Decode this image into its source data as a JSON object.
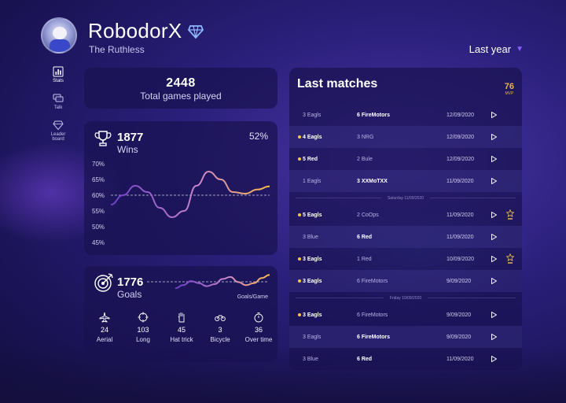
{
  "profile": {
    "name": "RobodorX",
    "title": "The Ruthless",
    "rank_icon": "diamond-icon"
  },
  "period": {
    "label": "Last year"
  },
  "nav": [
    {
      "label": "Stats",
      "icon": "bar-chart-icon",
      "active": true
    },
    {
      "label": "Talk",
      "icon": "chat-icon",
      "active": false
    },
    {
      "label": "Leader board",
      "icon": "diamond-icon",
      "active": false
    }
  ],
  "total": {
    "value": "2448",
    "label": "Total games played"
  },
  "wins": {
    "value": "1877",
    "label": "Wins",
    "percent": "52%",
    "chart_data": {
      "type": "line",
      "yticks": [
        "70%",
        "65%",
        "60%",
        "55%",
        "50%",
        "45%"
      ],
      "ylim": [
        45,
        70
      ],
      "reference": 60,
      "values": [
        57,
        60,
        63,
        61,
        56,
        53,
        55,
        63,
        67.5,
        65,
        61,
        60.5,
        61.8,
        62.8
      ]
    }
  },
  "goals": {
    "value": "1776",
    "label": "Goals",
    "sublabel": "Goals/Game",
    "trend": [
      0.3,
      0.45,
      0.65,
      0.55,
      0.4,
      0.5,
      0.75,
      0.85,
      0.6,
      0.45,
      0.55,
      0.8,
      0.95
    ],
    "stats": [
      {
        "icon": "airplane-icon",
        "value": "24",
        "label": "Aerial"
      },
      {
        "icon": "crosshair-icon",
        "value": "103",
        "label": "Long"
      },
      {
        "icon": "hand-icon",
        "value": "45",
        "label": "Hat trick"
      },
      {
        "icon": "bicycle-icon",
        "value": "3",
        "label": "Bicycle"
      },
      {
        "icon": "stopwatch-icon",
        "value": "36",
        "label": "Over time"
      }
    ]
  },
  "matches": {
    "title": "Last matches",
    "mvp_count": "76",
    "mvp_label": "MVP",
    "rows": [
      {
        "team_a": "3 Eagls",
        "team_b": "6 FireMotors",
        "winner": "b",
        "date": "12/09/2020",
        "dot": false,
        "mvp": false
      },
      {
        "team_a": "4 Eagls",
        "team_b": "3 NRG",
        "winner": "a",
        "date": "12/09/2020",
        "dot": true,
        "mvp": false
      },
      {
        "team_a": "5 Red",
        "team_b": "2 Bule",
        "winner": "a",
        "date": "12/09/2020",
        "dot": true,
        "mvp": false
      },
      {
        "team_a": "1 Eagls",
        "team_b": "3 XXMoTXX",
        "winner": "b",
        "date": "11/09/2020",
        "dot": false,
        "mvp": false
      },
      {
        "divider": "Saturday 11/09/2020"
      },
      {
        "team_a": "5 Eagls",
        "team_b": "2 CoOps",
        "winner": "a",
        "date": "11/09/2020",
        "dot": true,
        "mvp": true
      },
      {
        "team_a": "3 Blue",
        "team_b": "6 Red",
        "winner": "b",
        "date": "11/09/2020",
        "dot": false,
        "mvp": false
      },
      {
        "team_a": "3 Eagls",
        "team_b": "1 Red",
        "winner": "a",
        "date": "10/09/2020",
        "dot": true,
        "mvp": true
      },
      {
        "team_a": "3 Eagls",
        "team_b": "6 FireMotors",
        "winner": "a",
        "date": "9/09/2020",
        "dot": true,
        "mvp": false
      },
      {
        "divider": "Friday 10/09/2020"
      },
      {
        "team_a": "3 Eagls",
        "team_b": "6 FireMotors",
        "winner": "a",
        "date": "9/09/2020",
        "dot": true,
        "mvp": false
      },
      {
        "team_a": "3 Eagls",
        "team_b": "6 FireMotors",
        "winner": "b",
        "date": "9/09/2020",
        "dot": false,
        "mvp": false
      },
      {
        "team_a": "3 Blue",
        "team_b": "6 Red",
        "winner": "b",
        "date": "11/09/2020",
        "dot": false,
        "mvp": false
      }
    ]
  },
  "colors": {
    "accent": "#8a5cff",
    "gold": "#f3c54a",
    "line_start": "#7a4fd6",
    "line_end": "#f6b84a"
  }
}
